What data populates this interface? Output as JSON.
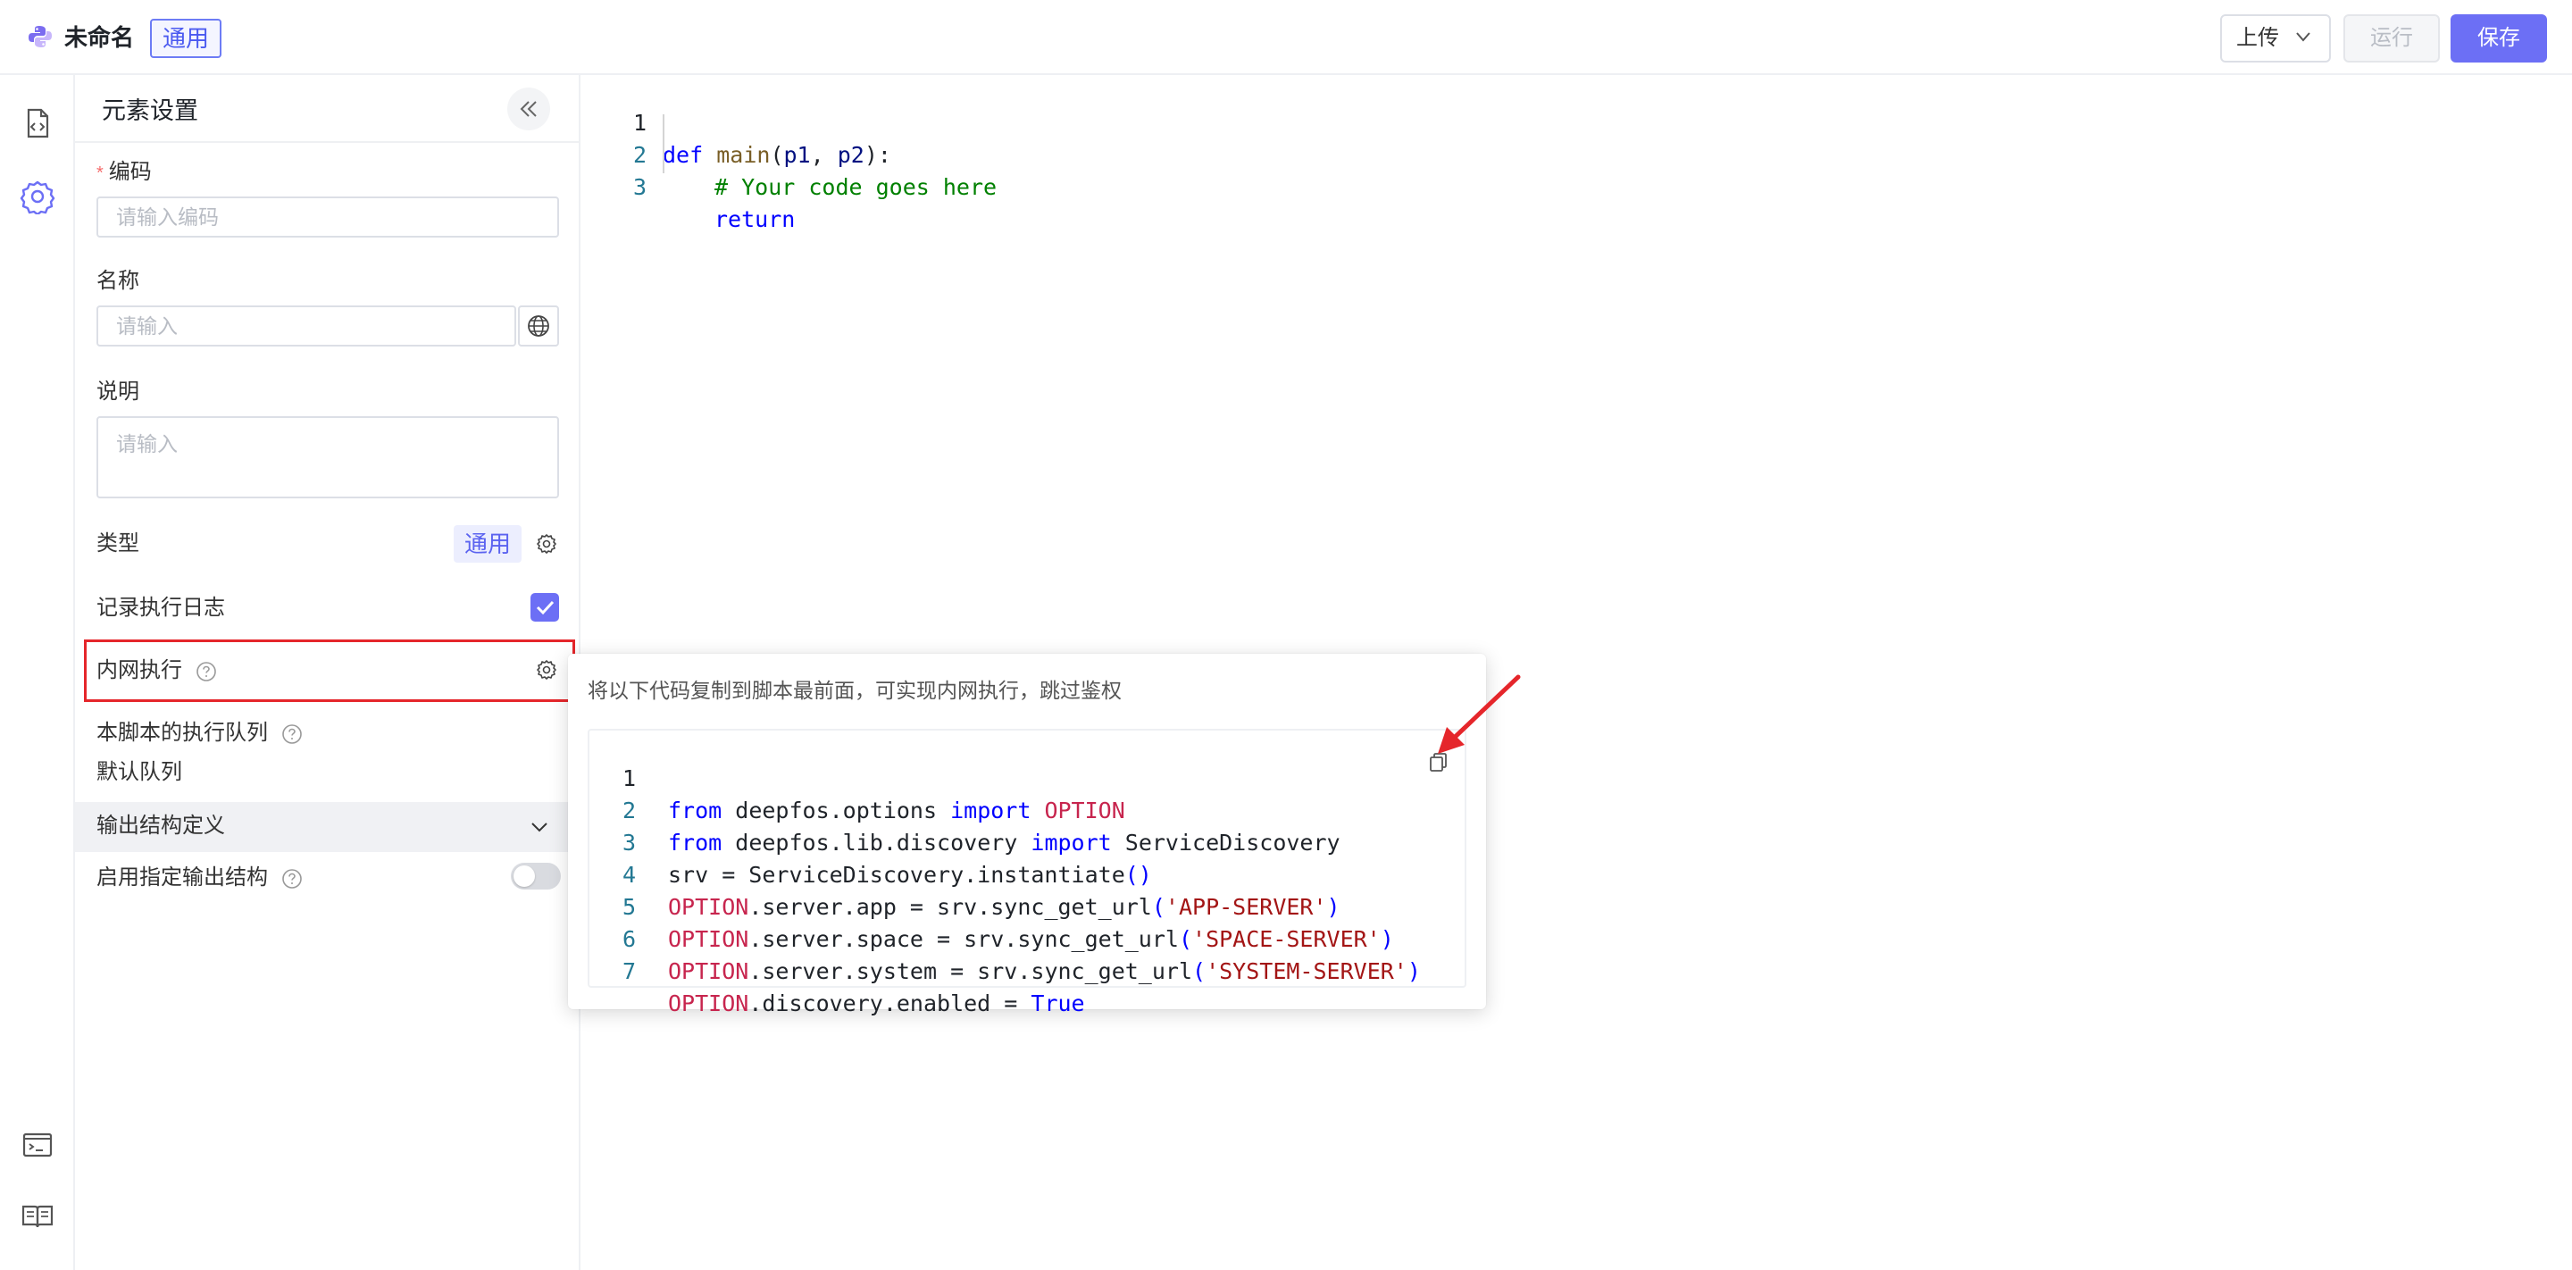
{
  "header": {
    "app_title": "未命名",
    "type_tag": "通用",
    "upload_label": "上传",
    "run_label": "运行",
    "save_label": "保存"
  },
  "rail": {
    "icons": [
      "code-file-icon",
      "settings-icon",
      "terminal-icon",
      "book-icon"
    ]
  },
  "panel": {
    "title": "元素设置",
    "code_label": "编码",
    "code_required_mark": "*",
    "code_placeholder": "请输入编码",
    "name_label": "名称",
    "name_placeholder": "请输入",
    "desc_label": "说明",
    "desc_placeholder": "请输入",
    "type_label": "类型",
    "type_value": "通用",
    "log_label": "记录执行日志",
    "log_checked": true,
    "intranet_label": "内网执行",
    "queue_label": "本脚本的执行队列",
    "queue_value": "默认队列",
    "output_section": "输出结构定义",
    "output_toggle_label": "启用指定输出结构",
    "output_toggle_on": false
  },
  "editor": {
    "lines": [
      {
        "num": "1",
        "active": true
      },
      {
        "num": "2",
        "active": false
      },
      {
        "num": "3",
        "active": false
      }
    ],
    "tokens": {
      "l1_def": "def",
      "l1_fn": "main",
      "l1_open": "(",
      "l1_p1": "p1",
      "l1_comma": ", ",
      "l1_p2": "p2",
      "l1_close": "):",
      "l2_comment": "# Your code goes here",
      "l3_return": "return"
    }
  },
  "popover": {
    "title": "将以下代码复制到脚本最前面，可实现内网执行，跳过鉴权",
    "line_numbers": [
      "1",
      "2",
      "3",
      "4",
      "5",
      "6",
      "7"
    ],
    "code": {
      "l1": {
        "kw1": "from",
        "mod": " deepfos.options ",
        "kw2": "import",
        "name": " OPTION"
      },
      "l2": {
        "kw1": "from",
        "mod": " deepfos.lib.discovery ",
        "kw2": "import",
        "name": " ServiceDiscovery"
      },
      "l3": {
        "text": "srv = ServiceDiscovery.instantiate",
        "paren": "()"
      },
      "l4": {
        "opt": "OPTION",
        "text": ".server.app = srv.sync_get_url",
        "open": "(",
        "str": "'APP-SERVER'",
        "close": ")"
      },
      "l5": {
        "opt": "OPTION",
        "text": ".server.space = srv.sync_get_url",
        "open": "(",
        "str": "'SPACE-SERVER'",
        "close": ")"
      },
      "l6": {
        "opt": "OPTION",
        "text": ".server.system = srv.sync_get_url",
        "open": "(",
        "str": "'SYSTEM-SERVER'",
        "close": ")"
      },
      "l7": {
        "opt": "OPTION",
        "text": ".discovery.enabled = ",
        "kw": "True"
      }
    }
  },
  "colors": {
    "accent": "#6c6ff5",
    "highlight": "#e5262b",
    "arrow": "#e5262b"
  }
}
